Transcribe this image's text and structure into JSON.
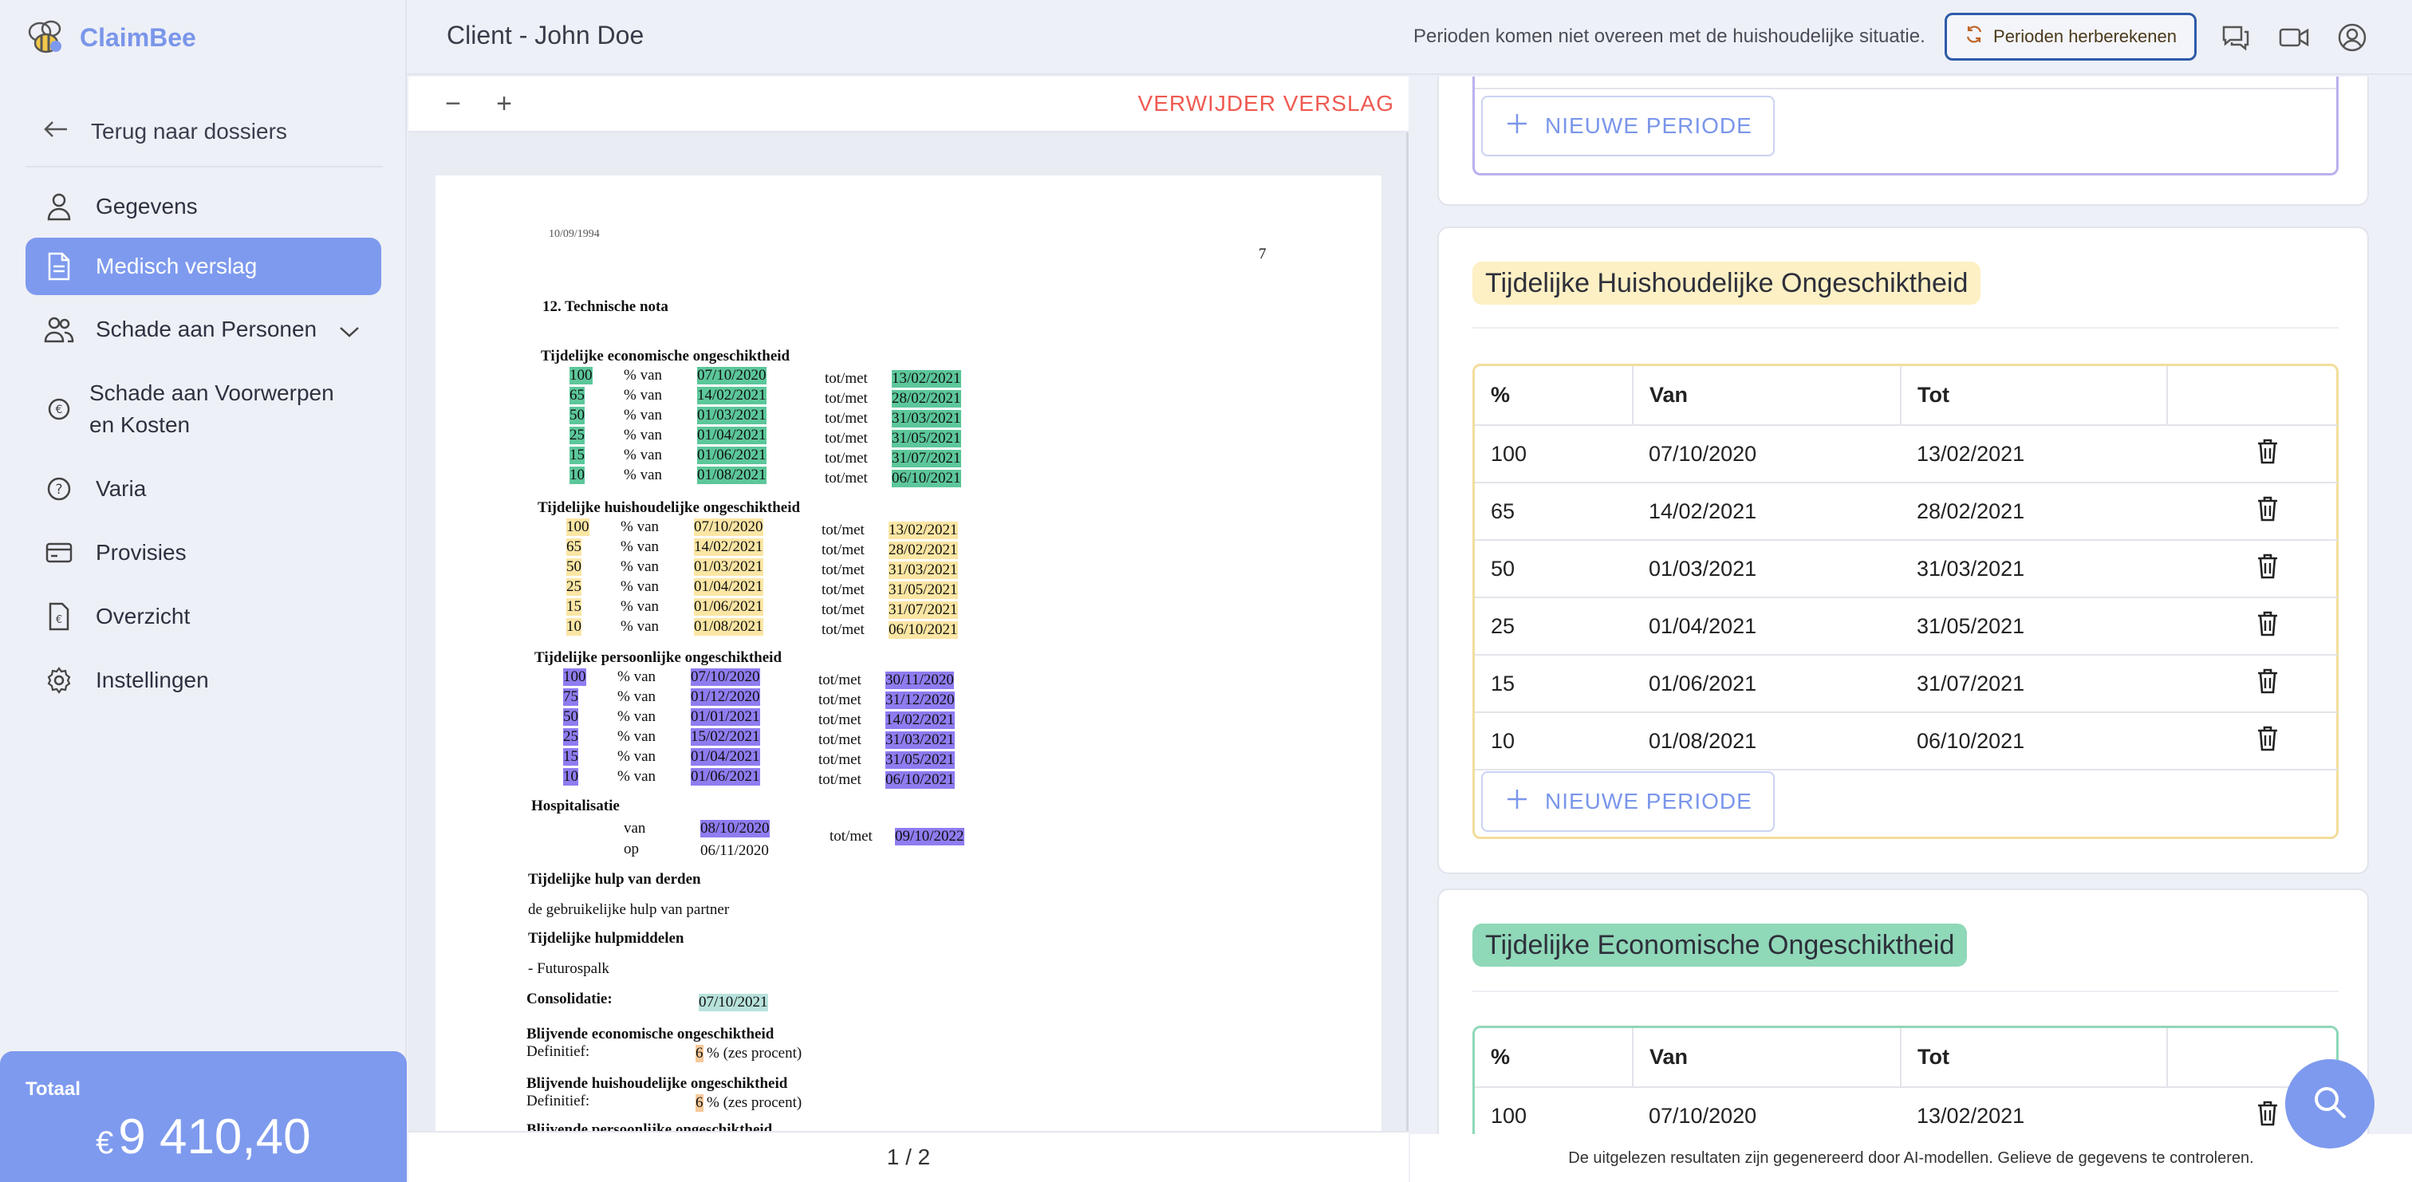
{
  "app": {
    "name": "ClaimBee",
    "brand_color": "#7e9aee"
  },
  "header": {
    "title": "Client - John Doe",
    "warning": "Perioden komen niet overeen met de huishoudelijke situatie.",
    "recalc_label": "Perioden herberekenen"
  },
  "sidebar": {
    "back_label": "Terug naar dossiers",
    "items": [
      {
        "label": "Gegevens",
        "icon": "user-icon"
      },
      {
        "label": "Medisch verslag",
        "icon": "document-icon",
        "active": true
      },
      {
        "label": "Schade aan Personen",
        "icon": "users-icon"
      },
      {
        "label": "Schade aan Voorwerpen en Kosten",
        "icon": "euro-icon"
      },
      {
        "label": "Varia",
        "icon": "question-icon"
      },
      {
        "label": "Provisies",
        "icon": "card-icon"
      },
      {
        "label": "Overzicht",
        "icon": "receipt-icon"
      },
      {
        "label": "Instellingen",
        "icon": "gear-icon"
      }
    ],
    "total_label": "Totaal",
    "total_currency": "€",
    "total_amount": "9 410,40"
  },
  "viewer": {
    "zoom_out": "−",
    "zoom_in": "+",
    "delete_label": "VERWIJDER VERSLAG",
    "page_indicator": "1 / 2",
    "doc": {
      "date_partial": "10/09/1994",
      "page_no": "7",
      "section": "12.  Technische nota",
      "econ_title": "Tijdelijke economische ongeschiktheid",
      "household_title": "Tijdelijke huishoudelijke ongeschiktheid",
      "personal_title": "Tijdelijke persoonlijke ongeschiktheid",
      "pct_van": "% van",
      "totmet": "tot/met",
      "econ_rows": [
        {
          "pct": "100",
          "from": "07/10/2020",
          "to": "13/02/2021"
        },
        {
          "pct": "65",
          "from": "14/02/2021",
          "to": "28/02/2021"
        },
        {
          "pct": "50",
          "from": "01/03/2021",
          "to": "31/03/2021"
        },
        {
          "pct": "25",
          "from": "01/04/2021",
          "to": "31/05/2021"
        },
        {
          "pct": "15",
          "from": "01/06/2021",
          "to": "31/07/2021"
        },
        {
          "pct": "10",
          "from": "01/08/2021",
          "to": "06/10/2021"
        }
      ],
      "household_rows": [
        {
          "pct": "100",
          "from": "07/10/2020",
          "to": "13/02/2021"
        },
        {
          "pct": "65",
          "from": "14/02/2021",
          "to": "28/02/2021"
        },
        {
          "pct": "50",
          "from": "01/03/2021",
          "to": "31/03/2021"
        },
        {
          "pct": "25",
          "from": "01/04/2021",
          "to": "31/05/2021"
        },
        {
          "pct": "15",
          "from": "01/06/2021",
          "to": "31/07/2021"
        },
        {
          "pct": "10",
          "from": "01/08/2021",
          "to": "06/10/2021"
        }
      ],
      "personal_rows": [
        {
          "pct": "100",
          "from": "07/10/2020",
          "to": "30/11/2020"
        },
        {
          "pct": "75",
          "from": "01/12/2020",
          "to": "31/12/2020"
        },
        {
          "pct": "50",
          "from": "01/01/2021",
          "to": "14/02/2021"
        },
        {
          "pct": "25",
          "from": "15/02/2021",
          "to": "31/03/2021"
        },
        {
          "pct": "15",
          "from": "01/04/2021",
          "to": "31/05/2021"
        },
        {
          "pct": "10",
          "from": "01/06/2021",
          "to": "06/10/2021"
        }
      ],
      "hosp_title": "Hospitalisatie",
      "hosp_van": "van",
      "hosp_op": "op",
      "hosp_from": "08/10/2020",
      "hosp_op_date": "06/11/2020",
      "hosp_to": "09/10/2022",
      "help_title": "Tijdelijke hulp van derden",
      "help_text": "de gebruikelijke hulp van partner",
      "aids_title": "Tijdelijke hulpmiddelen",
      "aids_text": "- Futurospalk",
      "consol_label": "Consolidatie:",
      "consol_date": "07/10/2021",
      "perm_econ_title": "Blijvende economische ongeschiktheid",
      "definitief": "Definitief:",
      "perm_value": "6",
      "perm_text": "% (zes procent)",
      "perm_house_title": "Blijvende huishoudelijke ongeschiktheid",
      "perm_pers_title": "Blijvende persoonlijke ongeschiktheid"
    }
  },
  "panel": {
    "new_period_label": "NIEUWE PERIODE",
    "household": {
      "title": "Tijdelijke Huishoudelijke Ongeschiktheid",
      "color": "#fdf0c4",
      "headers": [
        "%",
        "Van",
        "Tot",
        ""
      ],
      "rows": [
        {
          "pct": "100",
          "from": "07/10/2020",
          "to": "13/02/2021"
        },
        {
          "pct": "65",
          "from": "14/02/2021",
          "to": "28/02/2021"
        },
        {
          "pct": "50",
          "from": "01/03/2021",
          "to": "31/03/2021"
        },
        {
          "pct": "25",
          "from": "01/04/2021",
          "to": "31/05/2021"
        },
        {
          "pct": "15",
          "from": "01/06/2021",
          "to": "31/07/2021"
        },
        {
          "pct": "10",
          "from": "01/08/2021",
          "to": "06/10/2021"
        }
      ]
    },
    "economic": {
      "title": "Tijdelijke Economische Ongeschiktheid",
      "color": "#8fd8b8",
      "headers": [
        "%",
        "Van",
        "Tot",
        ""
      ],
      "rows": [
        {
          "pct": "100",
          "from": "07/10/2020",
          "to": "13/02/2021"
        }
      ]
    }
  },
  "footer_note": "De uitgelezen resultaten zijn gegenereerd door AI-modellen. Gelieve de gegevens te controleren."
}
